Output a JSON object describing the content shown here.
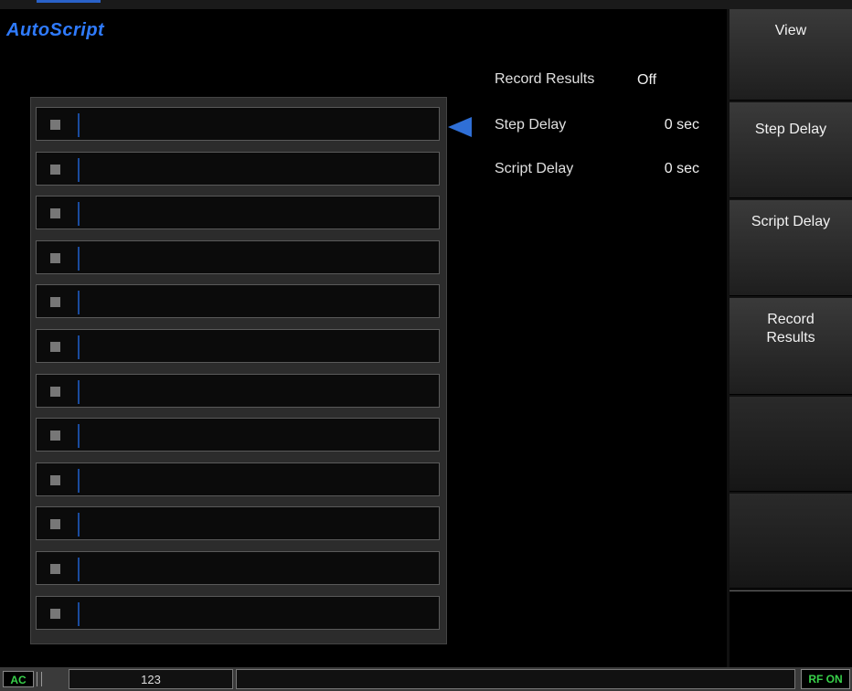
{
  "app": {
    "title": "AutoScript"
  },
  "list": {
    "row_count": 12
  },
  "params": [
    {
      "label": "Record Results",
      "value": "Off"
    },
    {
      "label": "Step Delay",
      "value": "0 sec"
    },
    {
      "label": "Script Delay",
      "value": "0 sec"
    }
  ],
  "softkeys": [
    {
      "label": "View"
    },
    {
      "label": "Step Delay"
    },
    {
      "label": "Script Delay"
    },
    {
      "label": "Record Results"
    },
    {
      "label": ""
    },
    {
      "label": ""
    }
  ],
  "status": {
    "ac": "AC",
    "number": "123",
    "message": "",
    "rf": "RF ON"
  },
  "colors": {
    "title": "#2f7bff",
    "pointer": "#2f6fd6",
    "status_green": "#38d14a"
  }
}
